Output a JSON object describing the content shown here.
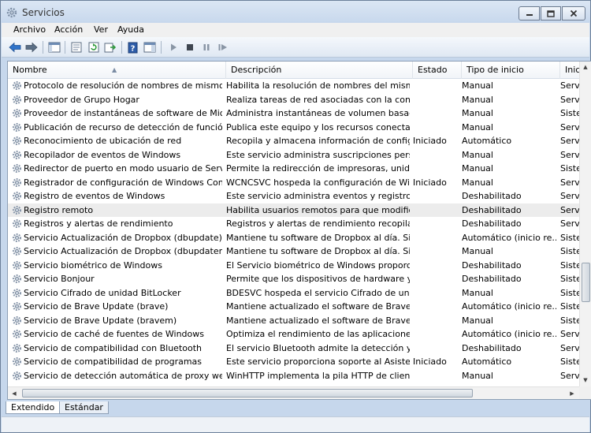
{
  "window": {
    "title": "Servicios"
  },
  "menu": [
    "Archivo",
    "Acción",
    "Ver",
    "Ayuda"
  ],
  "columns": {
    "name": "Nombre",
    "desc": "Descripción",
    "state": "Estado",
    "start": "Tipo de inicio",
    "login": "Inici"
  },
  "rows": [
    {
      "name": "Protocolo de resolución de nombres de mismo ni...",
      "desc": "Habilita la resolución de nombres del mismo...",
      "state": "",
      "start": "Manual",
      "login": "Serv"
    },
    {
      "name": "Proveedor de Grupo Hogar",
      "desc": "Realiza tareas de red asociadas con la config...",
      "state": "",
      "start": "Manual",
      "login": "Serv"
    },
    {
      "name": "Proveedor de instantáneas de software de Micros...",
      "desc": "Administra instantáneas de volumen basada...",
      "state": "",
      "start": "Manual",
      "login": "Siste"
    },
    {
      "name": "Publicación de recurso de detección de función",
      "desc": "Publica este equipo y los recursos conectado...",
      "state": "",
      "start": "Manual",
      "login": "Serv"
    },
    {
      "name": "Reconocimiento de ubicación de red",
      "desc": "Recopila y almacena información de configu...",
      "state": "Iniciado",
      "start": "Automático",
      "login": "Serv"
    },
    {
      "name": "Recopilador de eventos de Windows",
      "desc": "Este servicio administra suscripciones persist...",
      "state": "",
      "start": "Manual",
      "login": "Serv"
    },
    {
      "name": "Redirector de puerto en modo usuario de Servicio...",
      "desc": "Permite la redirección de impresoras, unidad...",
      "state": "",
      "start": "Manual",
      "login": "Siste"
    },
    {
      "name": "Registrador de configuración de Windows Conne...",
      "desc": "WCNCSVC hospeda la configuración de Win...",
      "state": "Iniciado",
      "start": "Manual",
      "login": "Serv"
    },
    {
      "name": "Registro de eventos de Windows",
      "desc": "Este servicio administra eventos y registros d...",
      "state": "",
      "start": "Deshabilitado",
      "login": "Serv"
    },
    {
      "name": "Registro remoto",
      "desc": "Habilita usuarios remotos para que modifiqu...",
      "state": "",
      "start": "Deshabilitado",
      "login": "Serv"
    },
    {
      "name": "Registros y alertas de rendimiento",
      "desc": "Registros y alertas de rendimiento recopila in...",
      "state": "",
      "start": "Deshabilitado",
      "login": "Serv"
    },
    {
      "name": "Servicio Actualización de Dropbox (dbupdate)",
      "desc": "Mantiene tu software de Dropbox al día. Si es...",
      "state": "",
      "start": "Automático (inicio re...",
      "login": "Siste"
    },
    {
      "name": "Servicio Actualización de Dropbox (dbupdatem)",
      "desc": "Mantiene tu software de Dropbox al día. Si es...",
      "state": "",
      "start": "Manual",
      "login": "Siste"
    },
    {
      "name": "Servicio biométrico de Windows",
      "desc": "El Servicio biométrico de Windows proporcio...",
      "state": "",
      "start": "Deshabilitado",
      "login": "Siste"
    },
    {
      "name": "Servicio Bonjour",
      "desc": "Permite que los dispositivos de hardware y lo...",
      "state": "",
      "start": "Deshabilitado",
      "login": "Siste"
    },
    {
      "name": "Servicio Cifrado de unidad BitLocker",
      "desc": "BDESVC hospeda el servicio Cifrado de unida...",
      "state": "",
      "start": "Manual",
      "login": "Siste"
    },
    {
      "name": "Servicio de Brave Update (brave)",
      "desc": "Mantiene actualizado el software de Brave. Si...",
      "state": "",
      "start": "Automático (inicio re...",
      "login": "Siste"
    },
    {
      "name": "Servicio de Brave Update (bravem)",
      "desc": "Mantiene actualizado el software de Brave. Si...",
      "state": "",
      "start": "Manual",
      "login": "Siste"
    },
    {
      "name": "Servicio de caché de fuentes de Windows",
      "desc": "Optimiza el rendimiento de las aplicaciones ...",
      "state": "",
      "start": "Automático (inicio re...",
      "login": "Serv"
    },
    {
      "name": "Servicio de compatibilidad con Bluetooth",
      "desc": "El servicio Bluetooth admite la detección y as...",
      "state": "",
      "start": "Deshabilitado",
      "login": "Serv"
    },
    {
      "name": "Servicio de compatibilidad de programas",
      "desc": "Este servicio proporciona soporte al Asistent...",
      "state": "Iniciado",
      "start": "Automático",
      "login": "Siste"
    },
    {
      "name": "Servicio de detección automática de proxy web ...",
      "desc": "WinHTTP implementa la pila HTTP de client...",
      "state": "",
      "start": "Manual",
      "login": "Serv"
    }
  ],
  "tabs": [
    "Extendido",
    "Estándar"
  ],
  "colors": {
    "accent": "#3a6fb7",
    "selection": "#ececec"
  }
}
